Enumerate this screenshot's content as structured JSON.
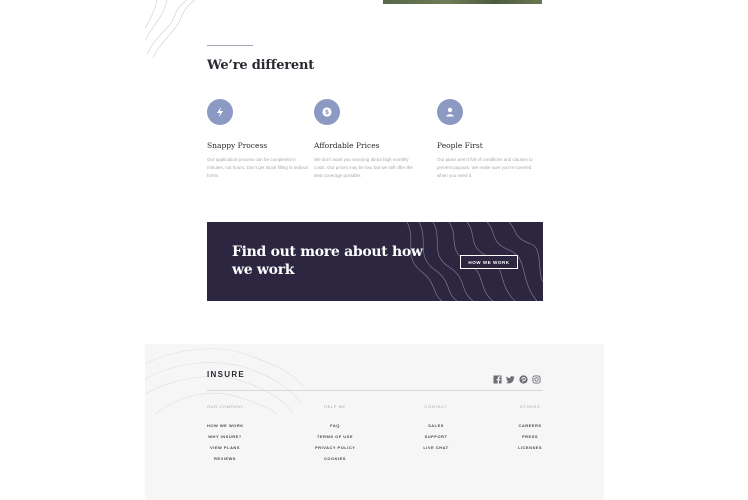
{
  "section": {
    "title": "We’re different"
  },
  "features": [
    {
      "icon": "lightning-icon",
      "title": "Snappy Process",
      "text": "Our application process can be completed in minutes, not hours. Don’t get stuck filling in tedious forms."
    },
    {
      "icon": "dollar-icon",
      "title": "Affordable Prices",
      "text": "We don’t want you worrying about high monthly costs. Our prices may be low, but we still offer the best coverage possible."
    },
    {
      "icon": "person-icon",
      "title": "People First",
      "text": "Our plans aren’t full of conditions and clauses to prevent payouts. We make sure you’re covered when you need it."
    }
  ],
  "cta": {
    "title": "Find out more about how we work",
    "button": "HOW WE WORK"
  },
  "footer": {
    "logo": "INSURE",
    "socials": [
      "facebook-icon",
      "twitter-icon",
      "pinterest-icon",
      "instagram-icon"
    ],
    "columns": [
      {
        "title": "OUR COMPANY",
        "links": [
          "HOW WE WORK",
          "WHY INSURE?",
          "VIEW PLANS",
          "REVIEWS"
        ]
      },
      {
        "title": "HELP ME",
        "links": [
          "FAQ",
          "TERMS OF USE",
          "PRIVACY POLICY",
          "COOKIES"
        ]
      },
      {
        "title": "CONTACT",
        "links": [
          "SALES",
          "SUPPORT",
          "LIVE CHAT"
        ]
      },
      {
        "title": "OTHERS",
        "links": [
          "CAREERS",
          "PRESS",
          "LICENSES"
        ]
      }
    ]
  }
}
